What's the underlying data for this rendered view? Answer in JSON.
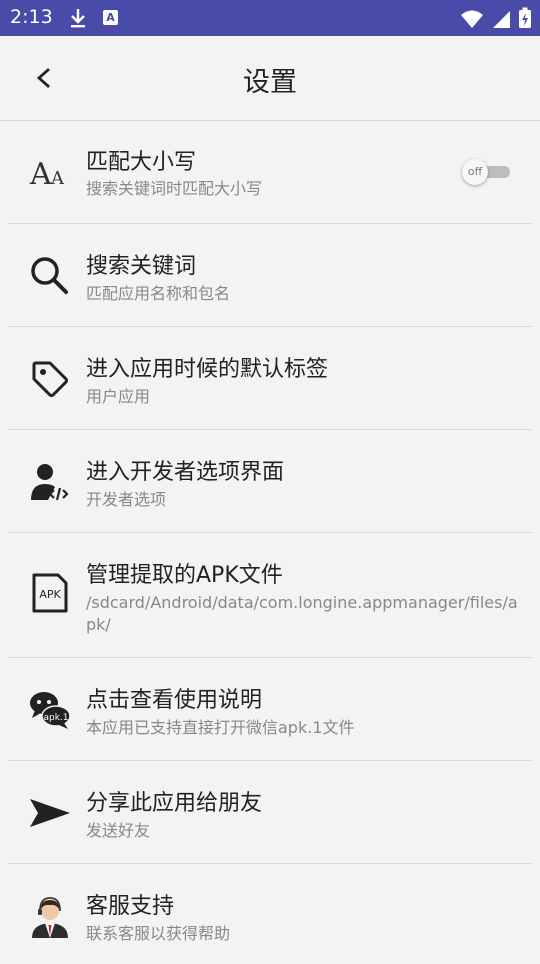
{
  "status_bar": {
    "time": "2:13",
    "badge_letter": "A"
  },
  "header": {
    "title": "设置"
  },
  "settings": [
    {
      "title": "匹配大小写",
      "subtitle": "搜索关键词时匹配大小写",
      "icon": "font-size-icon",
      "toggle": {
        "label": "off",
        "state": false
      }
    },
    {
      "title": "搜索关键词",
      "subtitle": "匹配应用名称和包名",
      "icon": "search-icon"
    },
    {
      "title": "进入应用时候的默认标签",
      "subtitle": "用户应用",
      "icon": "tag-icon"
    },
    {
      "title": "进入开发者选项界面",
      "subtitle": "开发者选项",
      "icon": "developer-icon"
    },
    {
      "title": "管理提取的APK文件",
      "subtitle": "/sdcard/Android/data/com.longine.appmanager/files/apk/",
      "icon": "apk-file-icon",
      "icon_text": "APK"
    },
    {
      "title": "点击查看使用说明",
      "subtitle": "本应用已支持直接打开微信apk.1文件",
      "icon": "wechat-icon",
      "icon_text": "apk.1"
    },
    {
      "title": "分享此应用给朋友",
      "subtitle": "发送好友",
      "icon": "send-icon"
    },
    {
      "title": "客服支持",
      "subtitle": "联系客服以获得帮助",
      "icon": "support-agent-icon"
    }
  ]
}
